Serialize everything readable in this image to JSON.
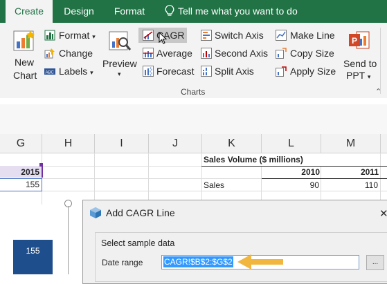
{
  "tabs": {
    "create": "Create",
    "design": "Design",
    "format": "Format",
    "tell_me": "Tell me what you want to do"
  },
  "ribbon": {
    "new_chart": [
      "New",
      "Chart"
    ],
    "format": "Format",
    "change": "Change",
    "labels": "Labels",
    "preview": "Preview",
    "cagr": "CAGR",
    "average": "Average",
    "forecast": "Forecast",
    "switch_axis": "Switch Axis",
    "second_axis": "Second Axis",
    "split_axis": "Split Axis",
    "make_line": "Make Line",
    "copy_size": "Copy Size",
    "apply_size": "Apply Size",
    "send_to_ppt": [
      "Send to",
      "PPT"
    ],
    "group_label": "Charts",
    "dropdown_glyph": "▾"
  },
  "sheet": {
    "columns": [
      "G",
      "H",
      "I",
      "J",
      "K",
      "L",
      "M"
    ],
    "table_title": "Sales Volume ($ millions)",
    "years": [
      "2010",
      "2011"
    ],
    "row_label": "Sales",
    "values": [
      "90",
      "110"
    ],
    "left_header": "2015",
    "left_value": "155"
  },
  "chart": {
    "bar_label": "155"
  },
  "dialog": {
    "title": "Add CAGR Line",
    "close": "✕",
    "group_label": "Select sample data",
    "range_label": "Date range",
    "range_value": "CAGR!$B$2:$G$2",
    "browse": "..."
  },
  "colors": {
    "excel_green": "#217346",
    "chart_blue": "#1f4e8c",
    "arrow_orange": "#f0b234",
    "selection": "#3399ff"
  }
}
